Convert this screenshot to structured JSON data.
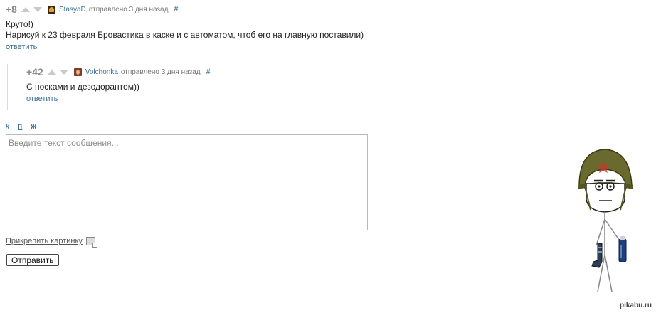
{
  "comments": [
    {
      "score": "+8",
      "user": "StasyaD",
      "meta": "отправлено 3 дня назад",
      "hash": "#",
      "text_lines": [
        "Круто!)",
        "Нарисуй к 23 февраля Бровастика в каске и с автоматом, чтоб его на главную поставили)"
      ],
      "reply": "ответить"
    },
    {
      "score": "+42",
      "user": "Volchonka",
      "meta": "отправлено 3 дня назад",
      "hash": "#",
      "text_lines": [
        "С носками и дезодорантом))"
      ],
      "reply": "ответить"
    }
  ],
  "editor": {
    "format_buttons": [
      "к",
      "п",
      "ж"
    ],
    "placeholder": "Введите текст сообщения...",
    "attach_label": "Прикрепить картинку",
    "submit_label": "Отправить"
  },
  "watermark": "pikabu.ru",
  "icons": {
    "up_arrow": "up-arrow-icon",
    "down_arrow": "down-arrow-icon",
    "attach": "picture-icon"
  }
}
